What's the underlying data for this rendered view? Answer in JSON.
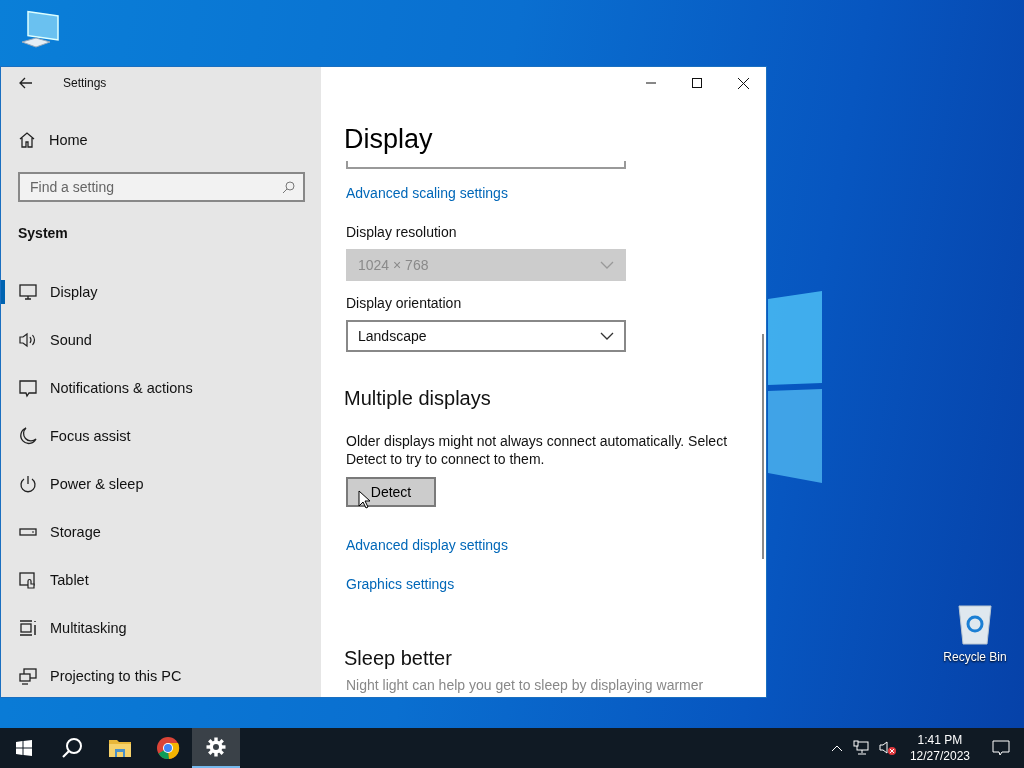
{
  "desktop": {
    "icons": [
      {
        "kind": "pc"
      },
      {
        "kind": "recycle",
        "label": "Recycle Bin"
      }
    ]
  },
  "window": {
    "title": "Settings",
    "sidebar": {
      "home": "Home",
      "search": {
        "placeholder": "Find a setting"
      },
      "section": "System",
      "items": [
        {
          "label": "Display",
          "selected": true
        },
        {
          "label": "Sound",
          "selected": false
        },
        {
          "label": "Notifications & actions",
          "selected": false
        },
        {
          "label": "Focus assist",
          "selected": false
        },
        {
          "label": "Power & sleep",
          "selected": false
        },
        {
          "label": "Storage",
          "selected": false
        },
        {
          "label": "Tablet",
          "selected": false
        },
        {
          "label": "Multitasking",
          "selected": false
        },
        {
          "label": "Projecting to this PC",
          "selected": false
        }
      ]
    },
    "content": {
      "heading": "Display",
      "scaling_link": "Advanced scaling settings",
      "resolution": {
        "label": "Display resolution",
        "value": "1024 × 768",
        "disabled": true
      },
      "orientation": {
        "label": "Display orientation",
        "value": "Landscape",
        "disabled": false
      },
      "multiple_heading": "Multiple displays",
      "multiple_text": "Older displays might not always connect automatically. Select Detect to try to connect to them.",
      "detect_button": "Detect",
      "links": [
        "Advanced display settings",
        "Graphics settings"
      ],
      "sleep_heading": "Sleep better",
      "sleep_text": "Night light can help you get to sleep by displaying warmer"
    }
  },
  "taskbar": {
    "apps": [
      {
        "kind": "start",
        "selected": false
      },
      {
        "kind": "search",
        "selected": false
      },
      {
        "kind": "folder",
        "selected": false
      },
      {
        "kind": "browser",
        "selected": false
      },
      {
        "kind": "settings",
        "selected": true
      }
    ],
    "time": "1:41 PM",
    "date": "12/27/2023"
  }
}
